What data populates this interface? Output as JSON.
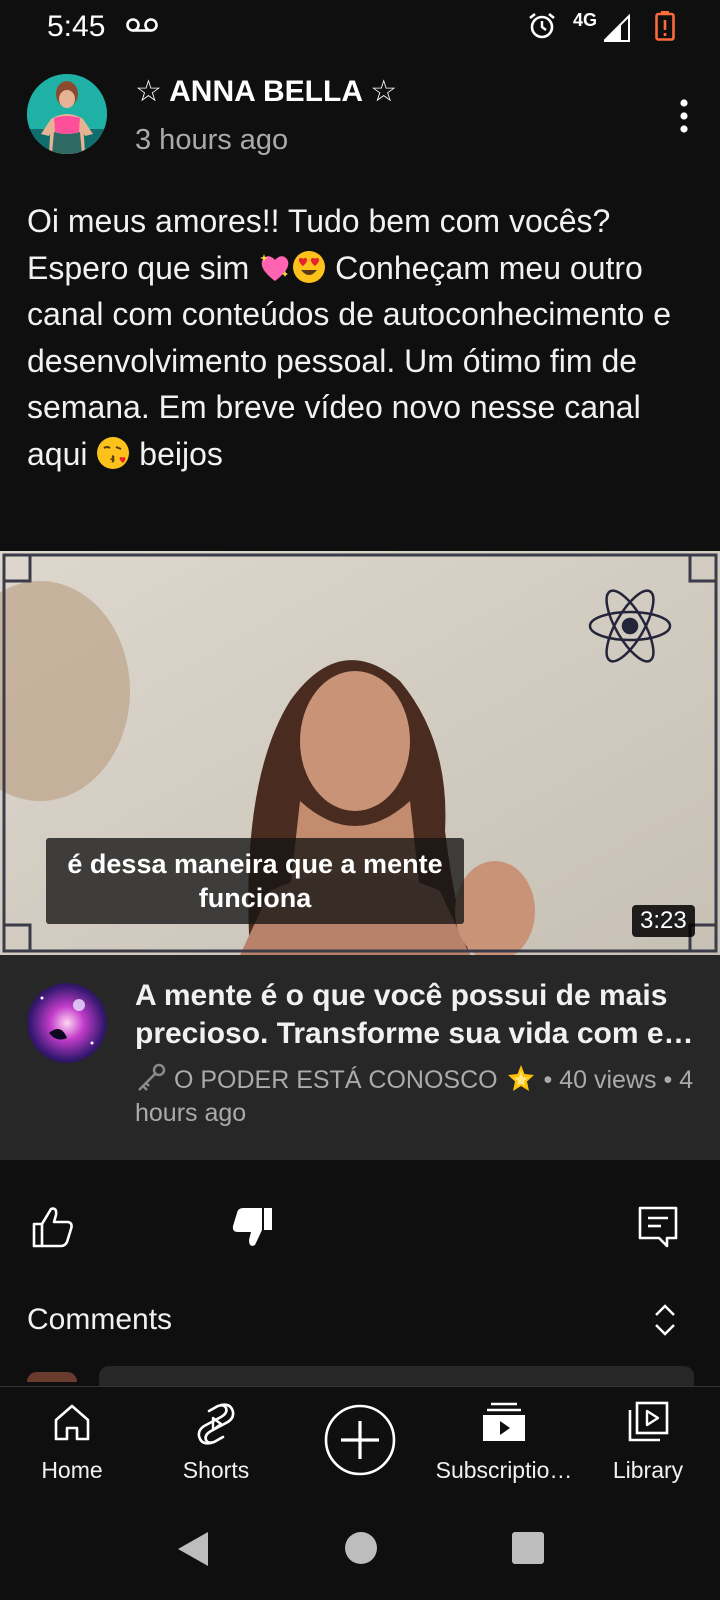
{
  "status_bar": {
    "time": "5:45",
    "network": "4G",
    "icons": [
      "voicemail-icon",
      "alarm-icon",
      "signal-icon",
      "battery-low-icon"
    ],
    "battery_color": "#ff6a3d"
  },
  "post": {
    "author": "☆ ANNA BELLA ☆",
    "posted": "3 hours ago",
    "text_parts": [
      "Oi meus amores!! Tudo bem com vocês? Espero que sim ",
      " Conheçam meu outro canal com conteúdos de autoconhecimento e desenvolvimento pessoal. Um ótimo fim de semana. Em breve vídeo novo nesse canal aqui ",
      " beijos"
    ],
    "emojis": [
      "sparkling-heart-emoji",
      "heart-eyes-emoji",
      "kissing-face-emoji"
    ]
  },
  "video": {
    "caption": "é dessa maneira que a mente funciona",
    "duration": "3:23",
    "title": "A mente é o que você possui de mais precioso. Transforme sua vida com e…",
    "channel": "O PODER ESTÁ CONOSCO",
    "views": "40 views",
    "separator": "•",
    "uploaded": "4 hours ago"
  },
  "actions": {
    "like_icon": "thumbs-up-icon",
    "dislike_icon": "thumbs-down-filled-icon",
    "comment_icon": "comment-icon"
  },
  "comments": {
    "label": "Comments"
  },
  "bottom_nav": {
    "items": [
      {
        "label": "Home",
        "icon": "home-icon"
      },
      {
        "label": "Shorts",
        "icon": "shorts-icon"
      },
      {
        "label": "",
        "icon": "create-plus-icon"
      },
      {
        "label": "Subscriptio…",
        "icon": "subscriptions-icon"
      },
      {
        "label": "Library",
        "icon": "library-icon"
      }
    ]
  },
  "colors": {
    "background": "#0f0f0f",
    "card": "#272727",
    "secondary_text": "#aaaaaa",
    "primary_text": "#f1f1f1"
  }
}
